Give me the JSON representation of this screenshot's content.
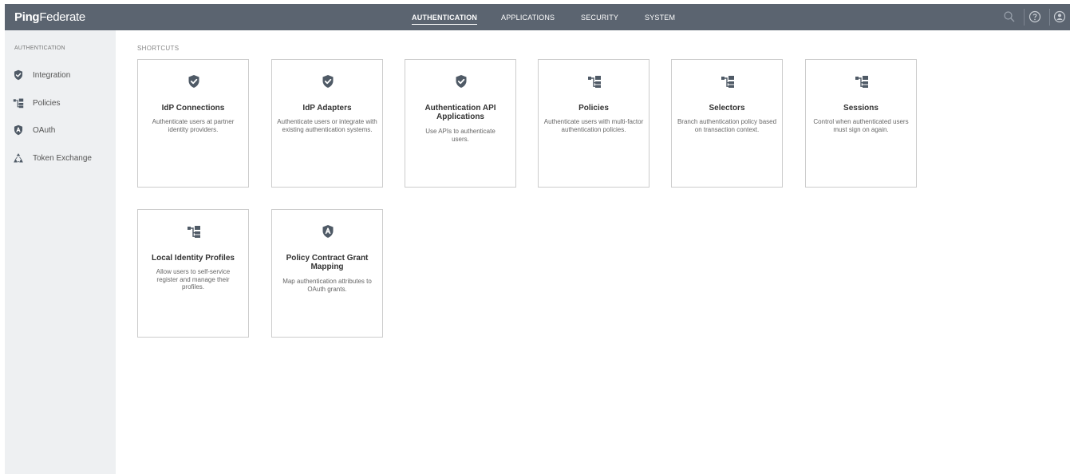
{
  "brand": {
    "part1": "Ping",
    "part2": "Federate"
  },
  "nav": [
    {
      "label": "AUTHENTICATION",
      "active": true
    },
    {
      "label": "APPLICATIONS",
      "active": false
    },
    {
      "label": "SECURITY",
      "active": false
    },
    {
      "label": "SYSTEM",
      "active": false
    }
  ],
  "sidebar": {
    "heading": "AUTHENTICATION",
    "items": [
      {
        "label": "Integration",
        "icon": "shield-check-icon"
      },
      {
        "label": "Policies",
        "icon": "policy-tree-icon"
      },
      {
        "label": "OAuth",
        "icon": "oauth-shield-icon"
      },
      {
        "label": "Token Exchange",
        "icon": "token-exchange-icon"
      }
    ]
  },
  "main": {
    "shortcuts_title": "SHORTCUTS",
    "cards": [
      {
        "title": "IdP Connections",
        "desc": "Authenticate users at partner identity providers.",
        "icon": "shield-check-icon"
      },
      {
        "title": "IdP Adapters",
        "desc": "Authenticate users or integrate with existing authentication systems.",
        "icon": "shield-check-icon"
      },
      {
        "title": "Authentication API Applications",
        "desc": "Use APIs to authenticate users.",
        "icon": "shield-check-icon"
      },
      {
        "title": "Policies",
        "desc": "Authenticate users with multi-factor authentication policies.",
        "icon": "policy-tree-icon"
      },
      {
        "title": "Selectors",
        "desc": "Branch authentication policy based on transaction context.",
        "icon": "policy-tree-icon"
      },
      {
        "title": "Sessions",
        "desc": "Control when authenticated users must sign on again.",
        "icon": "policy-tree-icon"
      },
      {
        "title": "Local Identity Profiles",
        "desc": "Allow users to self-service register and manage their profiles.",
        "icon": "policy-tree-icon"
      },
      {
        "title": "Policy Contract Grant Mapping",
        "desc": "Map authentication attributes to OAuth grants.",
        "icon": "oauth-shield-icon"
      }
    ]
  },
  "top_icons": [
    "search-icon",
    "help-icon",
    "user-icon"
  ],
  "colors": {
    "topbar": "#5b6470",
    "sidebar": "#eef0f2",
    "icon": "#4f5a66"
  }
}
